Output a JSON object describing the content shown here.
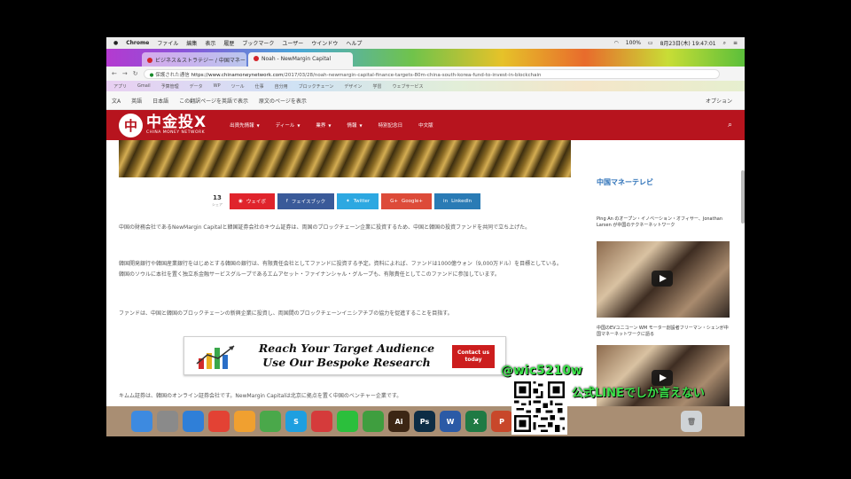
{
  "menubar": {
    "app": "Chrome",
    "items": [
      "ファイル",
      "編集",
      "表示",
      "履歴",
      "ブックマーク",
      "ユーザー",
      "ウインドウ",
      "ヘルプ"
    ],
    "battery": "100%",
    "datetime": "8月23日(木) 19:47:01"
  },
  "tabs": [
    {
      "label": "ビジネス＆ストラテジー / 中国マネー",
      "active": false
    },
    {
      "label": "Noah - NewMargin Capital",
      "active": true
    }
  ],
  "address": {
    "secure_label": "保護された通信",
    "url_host": "https://www.chinamoneynetwork.com",
    "url_path": "/2017/03/28/noah-newmargin-capital-finance-targets-80m-china-south-korea-fund-to-invest-in-blockchain"
  },
  "bookmarks": [
    "アプリ",
    "Gmail",
    "予算管理",
    "データ",
    "WP",
    "ツール",
    "仕事",
    "自分用",
    "ブロックチェーン",
    "デザイン",
    "学習",
    "ウェブサービス"
  ],
  "translate": {
    "page_lang": "日本語",
    "detected": "英語",
    "translate_label": "この翻訳ページを英語で表示",
    "source_label": "原文のページを表示",
    "options_label": "オプション"
  },
  "site": {
    "logo_glyph": "中",
    "logo_main": "中金投X",
    "logo_sub": "CHINA MONEY NETWORK",
    "nav": [
      {
        "label": "出資先情報",
        "caret": true
      },
      {
        "label": "ディール",
        "caret": true
      },
      {
        "label": "業界",
        "caret": true
      },
      {
        "label": "情報",
        "caret": true
      },
      {
        "label": "特別記念日",
        "caret": false
      },
      {
        "label": "中文版",
        "caret": false
      }
    ]
  },
  "article": {
    "share_count": "13",
    "share_count_label": "シェア",
    "share_buttons": [
      {
        "label": "ウェイボ",
        "icon": "weibo-icon",
        "color": "#e0242c"
      },
      {
        "label": "フェイスブック",
        "icon": "facebook-icon",
        "color": "#3a5a99"
      },
      {
        "label": "Twitter",
        "icon": "twitter-icon",
        "color": "#2da8e1"
      },
      {
        "label": "Google+",
        "icon": "googleplus-icon",
        "color": "#dd4b39"
      },
      {
        "label": "LinkedIn",
        "icon": "linkedin-icon",
        "color": "#2a7bb5"
      }
    ],
    "paragraphs": [
      "中国の財務会社であるNewMargin Capitalと韓国証券会社のキウム証券は、両国のブロックチェーン企業に投資するため、中国と韓国の投資ファンドを共同で立ち上げた。",
      "韓国開発銀行や韓国産業銀行をはじめとする韓国の銀行は、有限責任会社としてファンドに投資する予定。資料によれば、ファンドは1000億ウォン（9,000万ドル）を目標としている。韓国のソウルに本社を置く独立系金融サービスグループであるエムアセット・ファイナンシャル・グループも、有限責任としてこのファンドに参加しています。",
      "ファンドは、中国と韓国のブロックチェーンの新興企業に投資し、両国間のブロックチェーンイニシアチブの協力を促進することを目指す。",
      "キムム証券は、韓国のオンライン証券会社です。NewMargin Capitalは北京に拠点を置く中国のベンチャー企業です。"
    ],
    "ad": {
      "line1": "Reach Your Target Audience",
      "line2": "Use Our Bespoke Research",
      "cta": "Contact us today"
    }
  },
  "sidebar": {
    "title": "中国マネーテレビ",
    "videos": [
      {
        "title": "Ping An のオープン・イノベーション・オフィサー、Jonathan Larsen が中国のテクネーネットワーク"
      },
      {
        "title": "中国のEVユニコーン WM モーター創設者フリーマン・シェンが中国マネーネットワークに語る"
      }
    ]
  },
  "dock": {
    "apps": [
      {
        "name": "finder-icon",
        "label": "",
        "color": "#3d8ae0"
      },
      {
        "name": "launchpad-icon",
        "label": "",
        "color": "#8a8a8a"
      },
      {
        "name": "safari-icon",
        "label": "",
        "color": "#2f7fd8"
      },
      {
        "name": "chrome-icon",
        "label": "",
        "color": "#e34234"
      },
      {
        "name": "photos-icon",
        "label": "",
        "color": "#f0a030"
      },
      {
        "name": "maps-icon",
        "label": "",
        "color": "#4aa84a"
      },
      {
        "name": "skype-icon",
        "label": "S",
        "color": "#1e9fe0"
      },
      {
        "name": "scrobbler-icon",
        "label": "",
        "color": "#d53b3b"
      },
      {
        "name": "line-icon",
        "label": "",
        "color": "#2bbf3c"
      },
      {
        "name": "evernote-icon",
        "label": "",
        "color": "#3f9e3f"
      },
      {
        "name": "illustrator-icon",
        "label": "Ai",
        "color": "#3c2614"
      },
      {
        "name": "photoshop-icon",
        "label": "Ps",
        "color": "#0d2d45"
      },
      {
        "name": "word-icon",
        "label": "W",
        "color": "#2b5aa6"
      },
      {
        "name": "excel-icon",
        "label": "X",
        "color": "#1f7a44"
      },
      {
        "name": "powerpoint-icon",
        "label": "P",
        "color": "#c8472a"
      }
    ],
    "trash": "trash-icon"
  },
  "overlay": {
    "handle": "@wic5210w",
    "line": "公式LINEでしか言えない"
  }
}
